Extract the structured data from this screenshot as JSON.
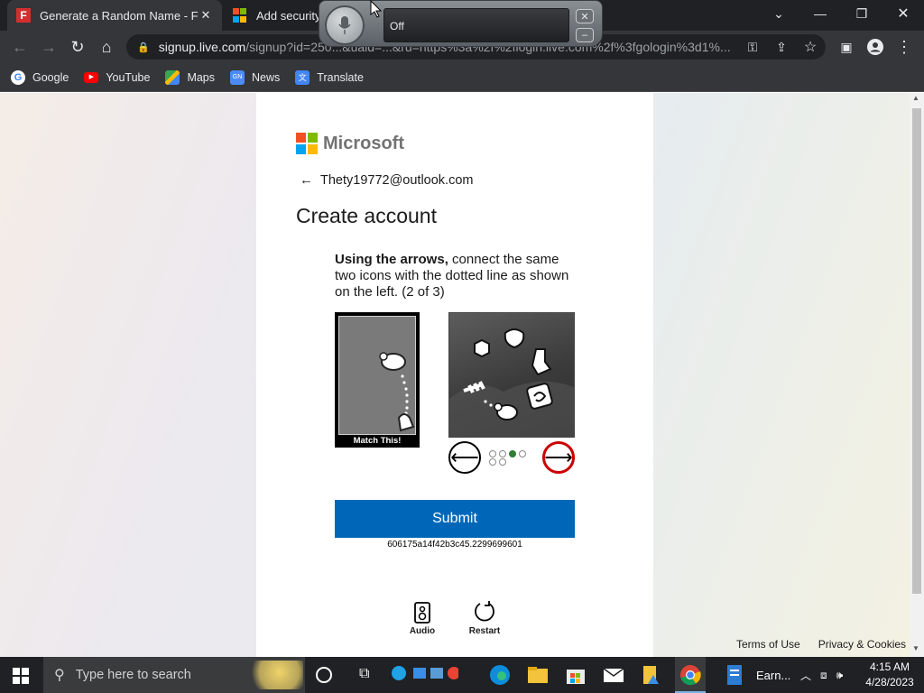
{
  "browser": {
    "tabs": [
      {
        "title": "Generate a Random Name - Fake"
      },
      {
        "title": "Add security"
      }
    ],
    "url_host": "signup.live.com",
    "url_path": "/signup?id=250...&uaid=...&ru=https%3a%2f%2flogin.live.com%2f%3fgologin%3d1%...",
    "bookmarks": [
      "Google",
      "YouTube",
      "Maps",
      "News",
      "Translate"
    ]
  },
  "speech": {
    "status": "Off"
  },
  "page": {
    "brand": "Microsoft",
    "email": "Thety19772@outlook.com",
    "title": "Create account",
    "instruction_bold": "Using the arrows,",
    "instruction_rest": " connect the same two icons with the dotted line as shown on the left. (2 of 3)",
    "match_label": "Match This!",
    "submit_label": "Submit",
    "transaction_id": "606175a14f42b3c45.2299699601",
    "audio_label": "Audio",
    "restart_label": "Restart",
    "footer_terms": "Terms of Use",
    "footer_privacy": "Privacy & Cookies",
    "active_step": 3,
    "step_count": 6
  },
  "taskbar": {
    "search_placeholder": "Type here to search",
    "earn_label": "Earn...",
    "time": "4:15 AM",
    "date": "4/28/2023"
  },
  "colors": {
    "ms_red": "#f25022",
    "ms_green": "#7fba00",
    "ms_blue": "#00a4ef",
    "ms_yellow": "#ffb900",
    "submit_blue": "#0067b8"
  }
}
